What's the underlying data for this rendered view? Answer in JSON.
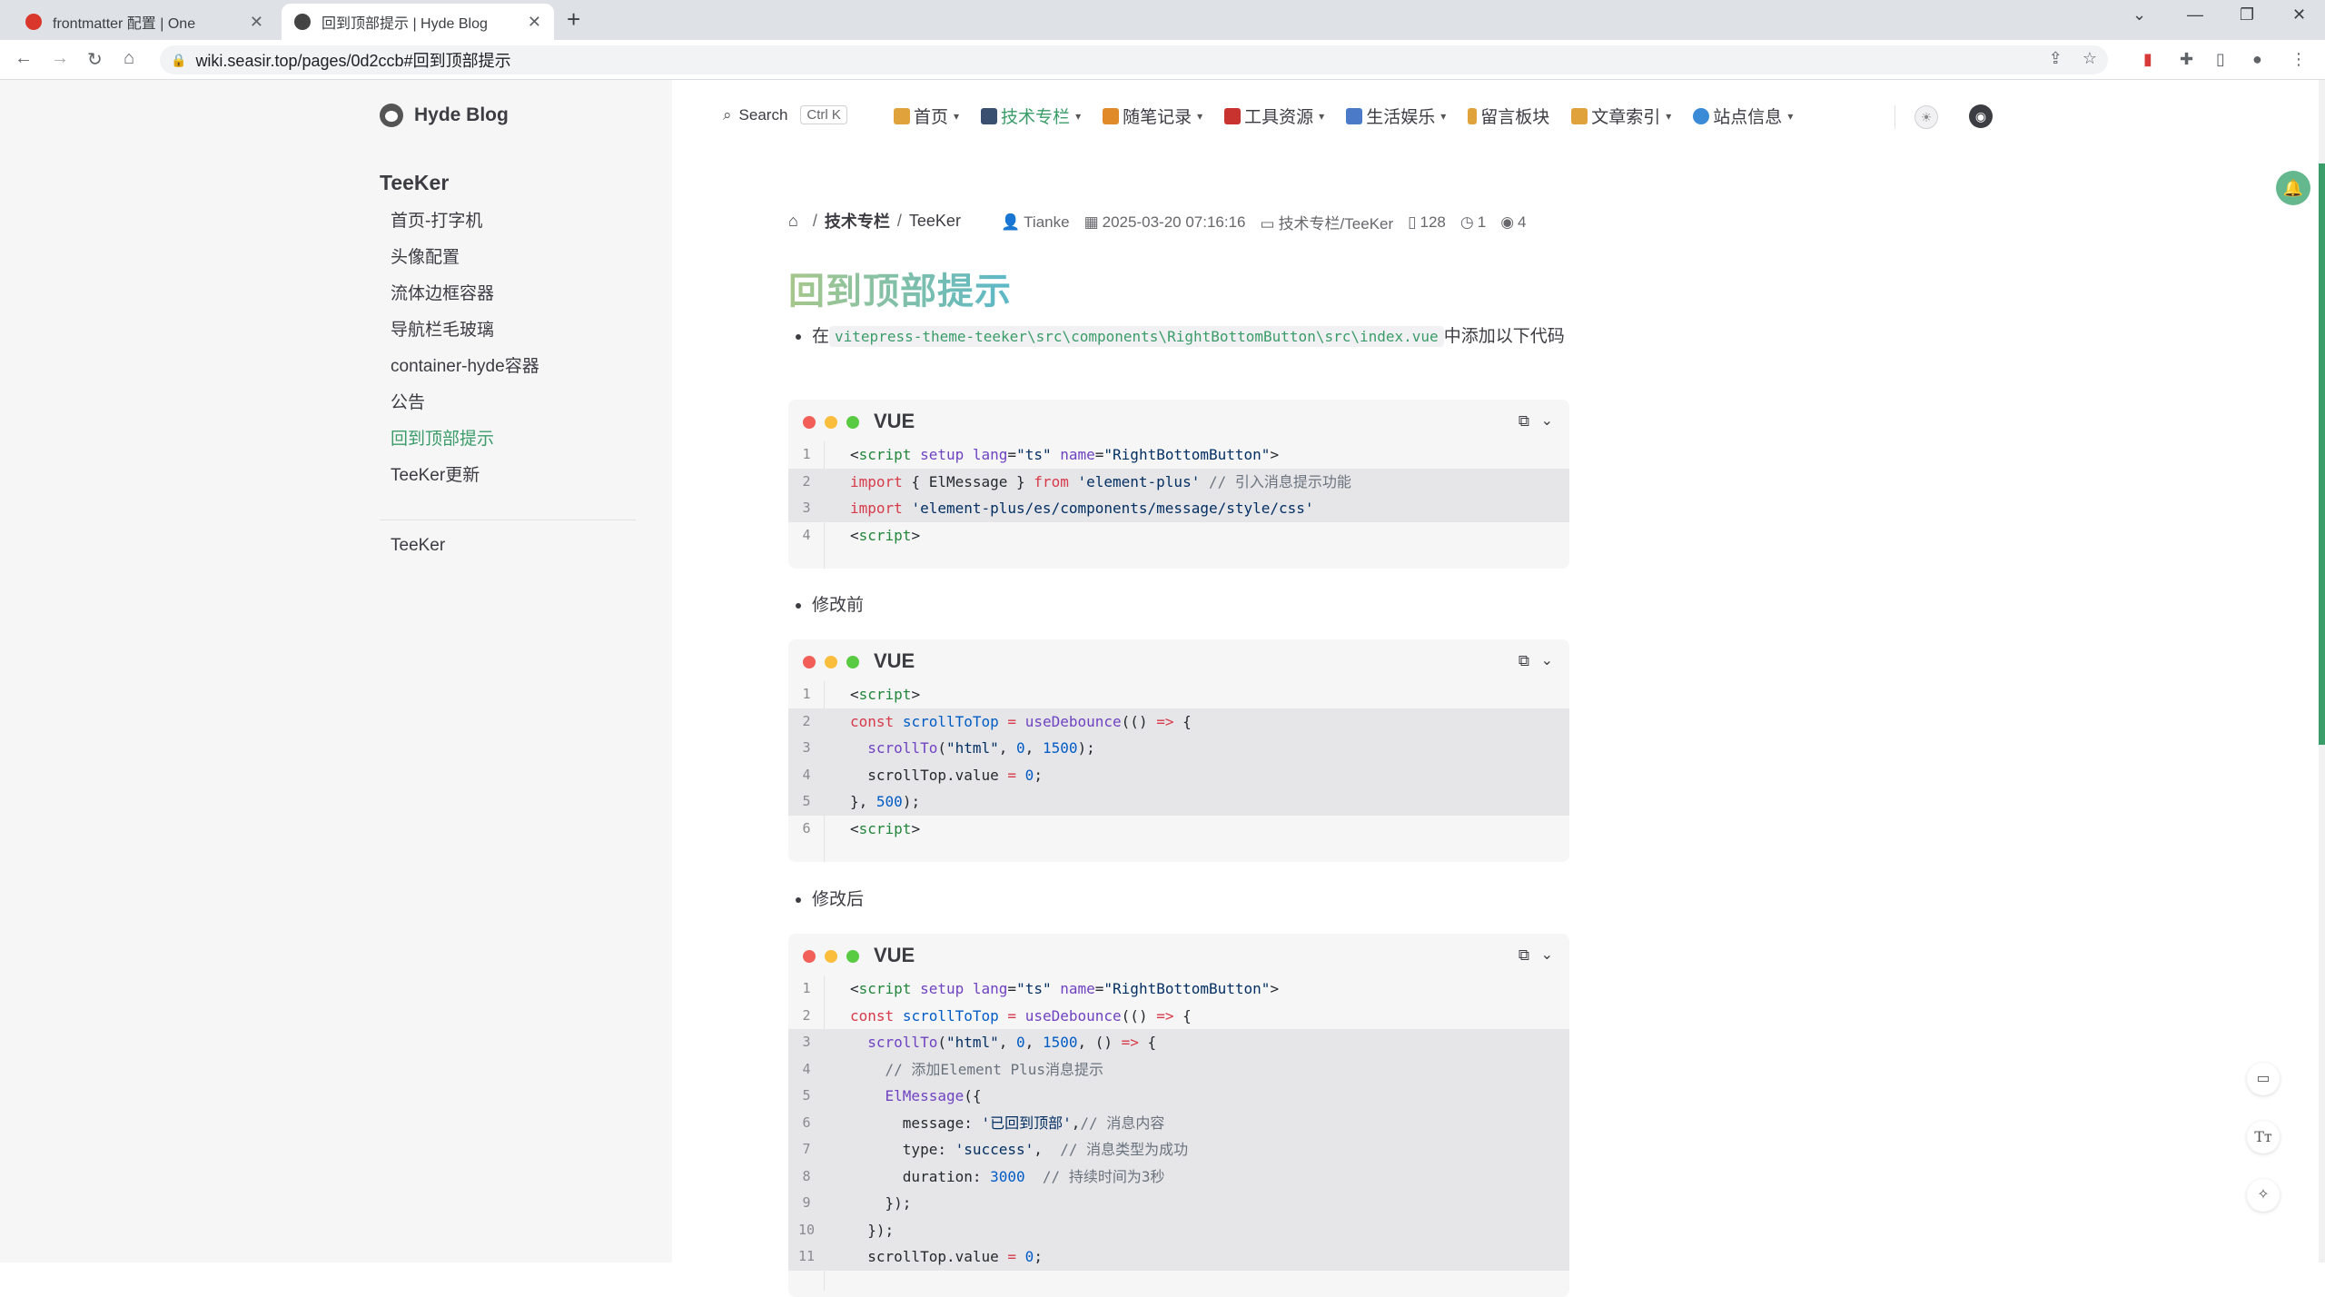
{
  "browser": {
    "tabs": [
      {
        "title": "frontmatter 配置 | One",
        "active": false,
        "favicon_color": "#d9372b"
      },
      {
        "title": "回到顶部提示 | Hyde Blog",
        "active": true,
        "favicon_color": "#444444"
      }
    ],
    "url": "wiki.seasir.top/pages/0d2ccb#回到顶部提示"
  },
  "sidebar": {
    "brand": "Hyde Blog",
    "group_title": "TeeKer",
    "items": [
      {
        "label": "首页-打字机",
        "active": false
      },
      {
        "label": "头像配置",
        "active": false
      },
      {
        "label": "流体边框容器",
        "active": false
      },
      {
        "label": "导航栏毛玻璃",
        "active": false
      },
      {
        "label": "container-hyde容器",
        "active": false
      },
      {
        "label": "公告",
        "active": false
      },
      {
        "label": "回到顶部提示",
        "active": true
      },
      {
        "label": "TeeKer更新",
        "active": false
      }
    ],
    "footer": "TeeKer"
  },
  "nav": {
    "search_label": "Search",
    "search_kbd": "Ctrl K",
    "items": [
      {
        "label": "首页",
        "emoji_color": "#e0a23a",
        "active": false
      },
      {
        "label": "技术专栏",
        "emoji_color": "#3a5070",
        "active": true
      },
      {
        "label": "随笔记录",
        "emoji_color": "#e08a2a",
        "active": false
      },
      {
        "label": "工具资源",
        "emoji_color": "#c8322f",
        "active": false
      },
      {
        "label": "生活娱乐",
        "emoji_color": "#4a7ac8",
        "active": false
      },
      {
        "label": "留言板块",
        "emoji_color": "#e0a23a",
        "active": false
      },
      {
        "label": "文章索引",
        "emoji_color": "#e0a23a",
        "active": false
      },
      {
        "label": "站点信息",
        "emoji_color": "#3a8ad8",
        "active": false
      }
    ]
  },
  "breadcrumb": {
    "section": "技术专栏",
    "page": "TeeKer"
  },
  "meta": {
    "author": "Tianke",
    "date": "2025-03-20 07:16:16",
    "category": "技术专栏/TeeKer",
    "words": "128",
    "minutes": "1",
    "views": "4"
  },
  "article": {
    "title": "回到顶部提示",
    "intro_prefix": "在",
    "intro_code": "vitepress-theme-teeker\\src\\components\\RightBottomButton\\src\\index.vue",
    "intro_suffix": "中添加以下代码",
    "before_label": "修改前",
    "after_label": "修改后",
    "code_lang": "VUE"
  },
  "code_blocks": [
    {
      "lines": [
        "1",
        "2",
        "3",
        "4"
      ]
    },
    {
      "lines": [
        "1",
        "2",
        "3",
        "4",
        "5",
        "6"
      ]
    },
    {
      "lines": [
        "1",
        "2",
        "3",
        "4",
        "5",
        "6",
        "7",
        "8",
        "9",
        "10",
        "11"
      ]
    }
  ],
  "colors": {
    "accent": "#3a9c69",
    "title_gradient_start": "#a6c78a",
    "title_gradient_end": "#5cb8c8"
  }
}
